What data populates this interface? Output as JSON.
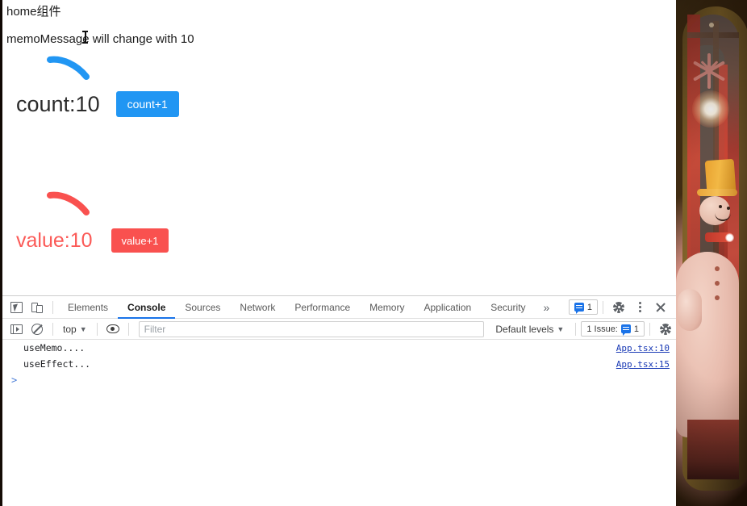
{
  "app": {
    "home_title": "home组件",
    "memo_message": "memoMessage will change with 10",
    "count_label": "count:10",
    "count_button": "count+1",
    "value_label": "value:10",
    "value_button": "value+1",
    "accent_blue": "#2196f3",
    "accent_red": "#f9514f",
    "annotation_blue_stroke": "blue-arc-annotation",
    "annotation_red_stroke": "red-arc-annotation"
  },
  "devtools": {
    "icons": {
      "inspect": "inspect-element-icon",
      "device": "device-toolbar-icon",
      "sidebar": "console-sidebar-icon",
      "clear": "clear-console-icon",
      "eye": "live-expression-icon",
      "settings": "gear-icon",
      "more": "kebab-menu-icon",
      "close": "close-icon",
      "message": "message-icon"
    },
    "tabs": [
      {
        "label": "Elements",
        "active": false
      },
      {
        "label": "Console",
        "active": true
      },
      {
        "label": "Sources",
        "active": false
      },
      {
        "label": "Network",
        "active": false
      },
      {
        "label": "Performance",
        "active": false
      },
      {
        "label": "Memory",
        "active": false
      },
      {
        "label": "Application",
        "active": false
      },
      {
        "label": "Security",
        "active": false
      }
    ],
    "more_tabs": "»",
    "message_badge_count": "1",
    "console": {
      "context": "top",
      "filter_placeholder": "Filter",
      "filter_value": "",
      "levels": "Default levels",
      "issues_label": "1 Issue:",
      "issues_count": "1",
      "prompt": ">",
      "messages": [
        {
          "text": "useMemo....",
          "source": "App.tsx:10"
        },
        {
          "text": "useEffect...",
          "source": "App.tsx:15"
        }
      ]
    }
  }
}
